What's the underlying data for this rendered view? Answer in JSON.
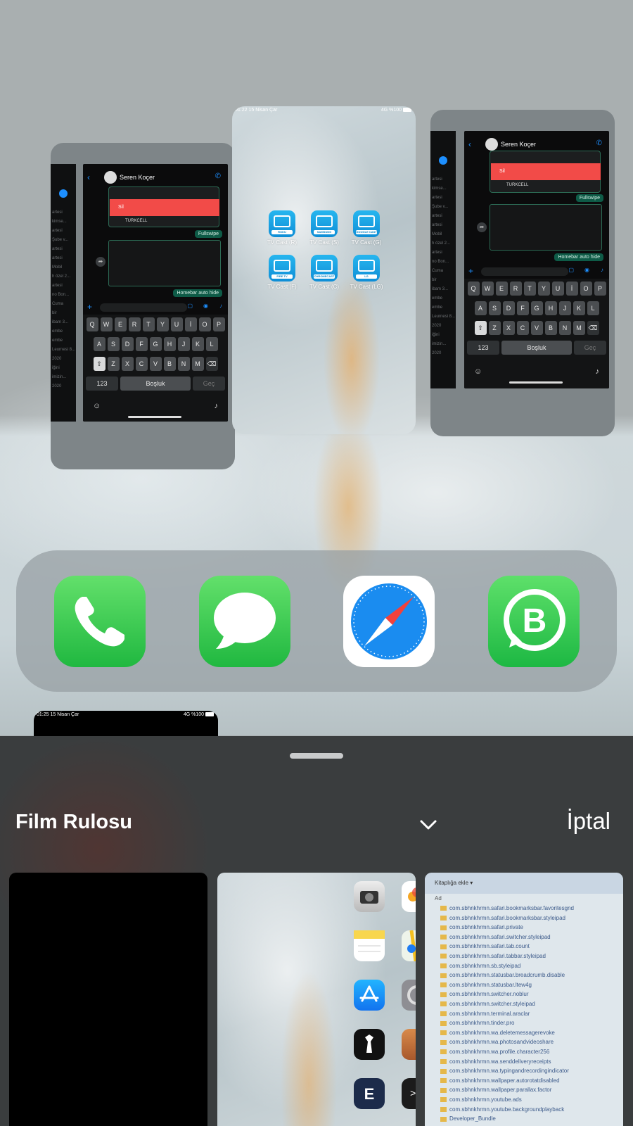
{
  "switcher": {
    "left_card": {
      "contact_name": "Seren Koçer",
      "delete_label": "Sil",
      "sender": "TURKCELL",
      "messages": [
        "Fullswipe",
        "Homebar auto hide"
      ],
      "sidebar_items": [
        "artesi",
        "kimse...",
        "artesi",
        "Şube v...",
        "artesi",
        "artesi",
        "Mobil",
        "h özel 2...",
        "artesi",
        "no Bon...",
        "Cuma",
        "bir",
        "ibam 3...",
        "embe",
        "embe",
        "Leurnesi 8...",
        "2020",
        "iğini",
        "imizin...",
        "2020"
      ]
    },
    "center_card": {
      "status_time": "01:22   15 Nisan Çar",
      "status_right": "4G %100",
      "apps": [
        {
          "label": "TV Cast (R)",
          "brand": "ROKU"
        },
        {
          "label": "TV Cast (S)",
          "brand": "SAMSUNG"
        },
        {
          "label": "TV Cast (G)",
          "brand": "GOOGLE CAST"
        },
        {
          "label": "TV Cast (F)",
          "brand": "FIRE TV"
        },
        {
          "label": "TV Cast (C)",
          "brand": "CHROMECAST"
        },
        {
          "label": "TV Cast (LG)",
          "brand": "LG"
        }
      ]
    },
    "right_card": {
      "contact_name": "Seren Koçer",
      "delete_label": "Sil",
      "sender": "TURKCELL",
      "messages": [
        "Fullswipe",
        "Homebar auto hide"
      ],
      "sidebar_items": [
        "artesi",
        "kimse...",
        "artesi",
        "Şube v...",
        "artesi",
        "artesi",
        "Mobil",
        "h özel 2...",
        "artesi",
        "no Bon...",
        "Cuma",
        "bir",
        "ibam 3...",
        "embe",
        "embe",
        "Leurnesi 8...",
        "2020",
        "iğini",
        "imizin...",
        "2020"
      ]
    },
    "keyboard": {
      "row1": [
        "Q",
        "W",
        "E",
        "R",
        "T",
        "Y",
        "U",
        "İ",
        "O",
        "P"
      ],
      "row2": [
        "A",
        "S",
        "D",
        "F",
        "G",
        "H",
        "J",
        "K",
        "L"
      ],
      "row3": [
        "Z",
        "X",
        "C",
        "V",
        "B",
        "N",
        "M"
      ],
      "num_key": "123",
      "space_key": "Boşluk",
      "go_key": "Geç"
    }
  },
  "dock": {
    "apps": [
      {
        "name": "Phone",
        "icon": "phone-icon"
      },
      {
        "name": "Messages",
        "icon": "messages-icon"
      },
      {
        "name": "Safari",
        "icon": "safari-icon"
      },
      {
        "name": "WhatsApp Business",
        "icon": "whatsapp-business-icon"
      }
    ]
  },
  "peek": {
    "status_time": "01:25   15 Nisan Çar",
    "status_right": "4G %100"
  },
  "sheet": {
    "album_title": "Film Rulosu",
    "cancel_label": "İptal",
    "thumb3_toolbar": "Kitaplığa ekle ▾",
    "thumb3_col_header": "Ad",
    "files": [
      "com.sbhnkhrmn.safari.bookmarksbar.favoritesgnd",
      "com.sbhnkhrmn.safari.bookmarksbar.styleipad",
      "com.sbhnkhrmn.safari.private",
      "com.sbhnkhrmn.safari.switcher.styleipad",
      "com.sbhnkhrmn.safari.tab.count",
      "com.sbhnkhrmn.safari.tabbar.styleipad",
      "com.sbhnkhrmn.sb.styleipad",
      "com.sbhnkhrmn.statusbar.breadcrumb.disable",
      "com.sbhnkhrmn.statusbar.ltew4g",
      "com.sbhnkhrmn.switcher.noblur",
      "com.sbhnkhrmn.switcher.styleipad",
      "com.sbhnkhrmn.terminal.araclar",
      "com.sbhnkhrmn.tinder.pro",
      "com.sbhnkhrmn.wa.deletemessagerevoke",
      "com.sbhnkhrmn.wa.photosandvideoshare",
      "com.sbhnkhrmn.wa.profile.character256",
      "com.sbhnkhrmn.wa.senddeliveryreceipts",
      "com.sbhnkhrmn.wa.typingandrecordingindicator",
      "com.sbhnkhrmn.wallpaper.autorotatdisabled",
      "com.sbhnkhrmn.wallpaper.parallax.factor",
      "com.sbhnkhrmn.youtube.ads",
      "com.sbhnkhrmn.youtube.backgroundplayback",
      "Developer_Bundle"
    ]
  }
}
